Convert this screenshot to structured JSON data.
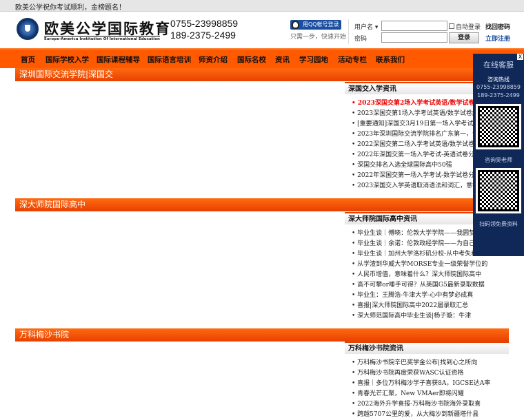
{
  "topbar": {
    "greeting": "欧美公学祝你考试顺利，金榜题名！"
  },
  "header": {
    "brand": "欧美公学国际教育",
    "brand_en": "Europe-America Institution Of International Education",
    "phone1": "0755-23998859",
    "phone2": "189-2375-2499",
    "qq_login": "用QQ帐号登录",
    "qq_sub": "只需一步，快速开始",
    "username_label": "用户名 ▾",
    "password_label": "密码",
    "auto_login": "自动登录",
    "login_btn": "登录",
    "forgot": "找回密码",
    "register": "立即注册"
  },
  "nav": [
    "首页",
    "国际学校入学",
    "国际课程辅导",
    "国际语言培训",
    "师资介绍",
    "国际名校",
    "资讯",
    "学习园地",
    "活动专栏",
    "联系我们"
  ],
  "sections": [
    {
      "title": "深圳国际交流学院|深国交",
      "news_title": "深国交入学资讯",
      "items": [
        "2023深国交第2场入学考试英语/数学试卷解",
        "2023深国交第1场入学考试英语/数学试卷解析",
        "[重要通知]深国交3月19日第一场入学考试安排",
        "2023年深圳国际交流学院排名广东第一，全国第",
        "2022深国交第二场入学考试英语/数学试卷解析",
        "2022年深国交第一场入学考试-英语试卷分析",
        "深国交排名入选全球国际高中50强",
        "2022年深国交第一场入学考试-数学试卷分析",
        "2023深国交入学英语取消语法和词汇，意欲何为"
      ]
    },
    {
      "title": "深大师院国际高中",
      "news_title": "深大师院国际高中资讯",
      "items": [
        "毕业生谈｜傅晓：伦敦大学学院——我圆梦了",
        "毕业生谈｜余诺：伦敦政经学院——为自己的",
        "毕业生谈｜加州大学洛杉矶分校-从中考失利",
        "从学渣到华威大学MORSE专业一级荣誉学位的",
        "人民币增值，意味着什么？深大师院国际高中",
        "高不可攀or唾手可得？从英国G5最新录取数据",
        "毕业生：王腾浩-牛津大学-心中有梦必成真",
        "喜报|深大师院国际高中2022届录取汇总",
        "深大师范国际高中毕业生谈|杨子璇：牛津"
      ]
    },
    {
      "title": "万科梅沙书院",
      "news_title": "万科梅沙书院资讯",
      "items": [
        "万科梅沙书院辛巴奖学金公布|找到心之所向",
        "万科梅沙书院再度荣获WASC认证资格",
        "喜报｜多位万科梅沙学子喜获8A，IGCSE达A率",
        "青春光芒汇聚，New VMAer即将闪耀",
        "2022海外升学喜报-万科梅沙书院海外录取喜",
        "跨越5707公里的爱，从大梅沙到新疆塔什县"
      ]
    }
  ],
  "float": {
    "title": "在线客服",
    "close": "X",
    "hotline": "咨询热线",
    "phone1": "0755-23998859",
    "phone2": "189-2375-2499",
    "consult": "咨询吴老师",
    "scan": "扫码领免费资料"
  }
}
